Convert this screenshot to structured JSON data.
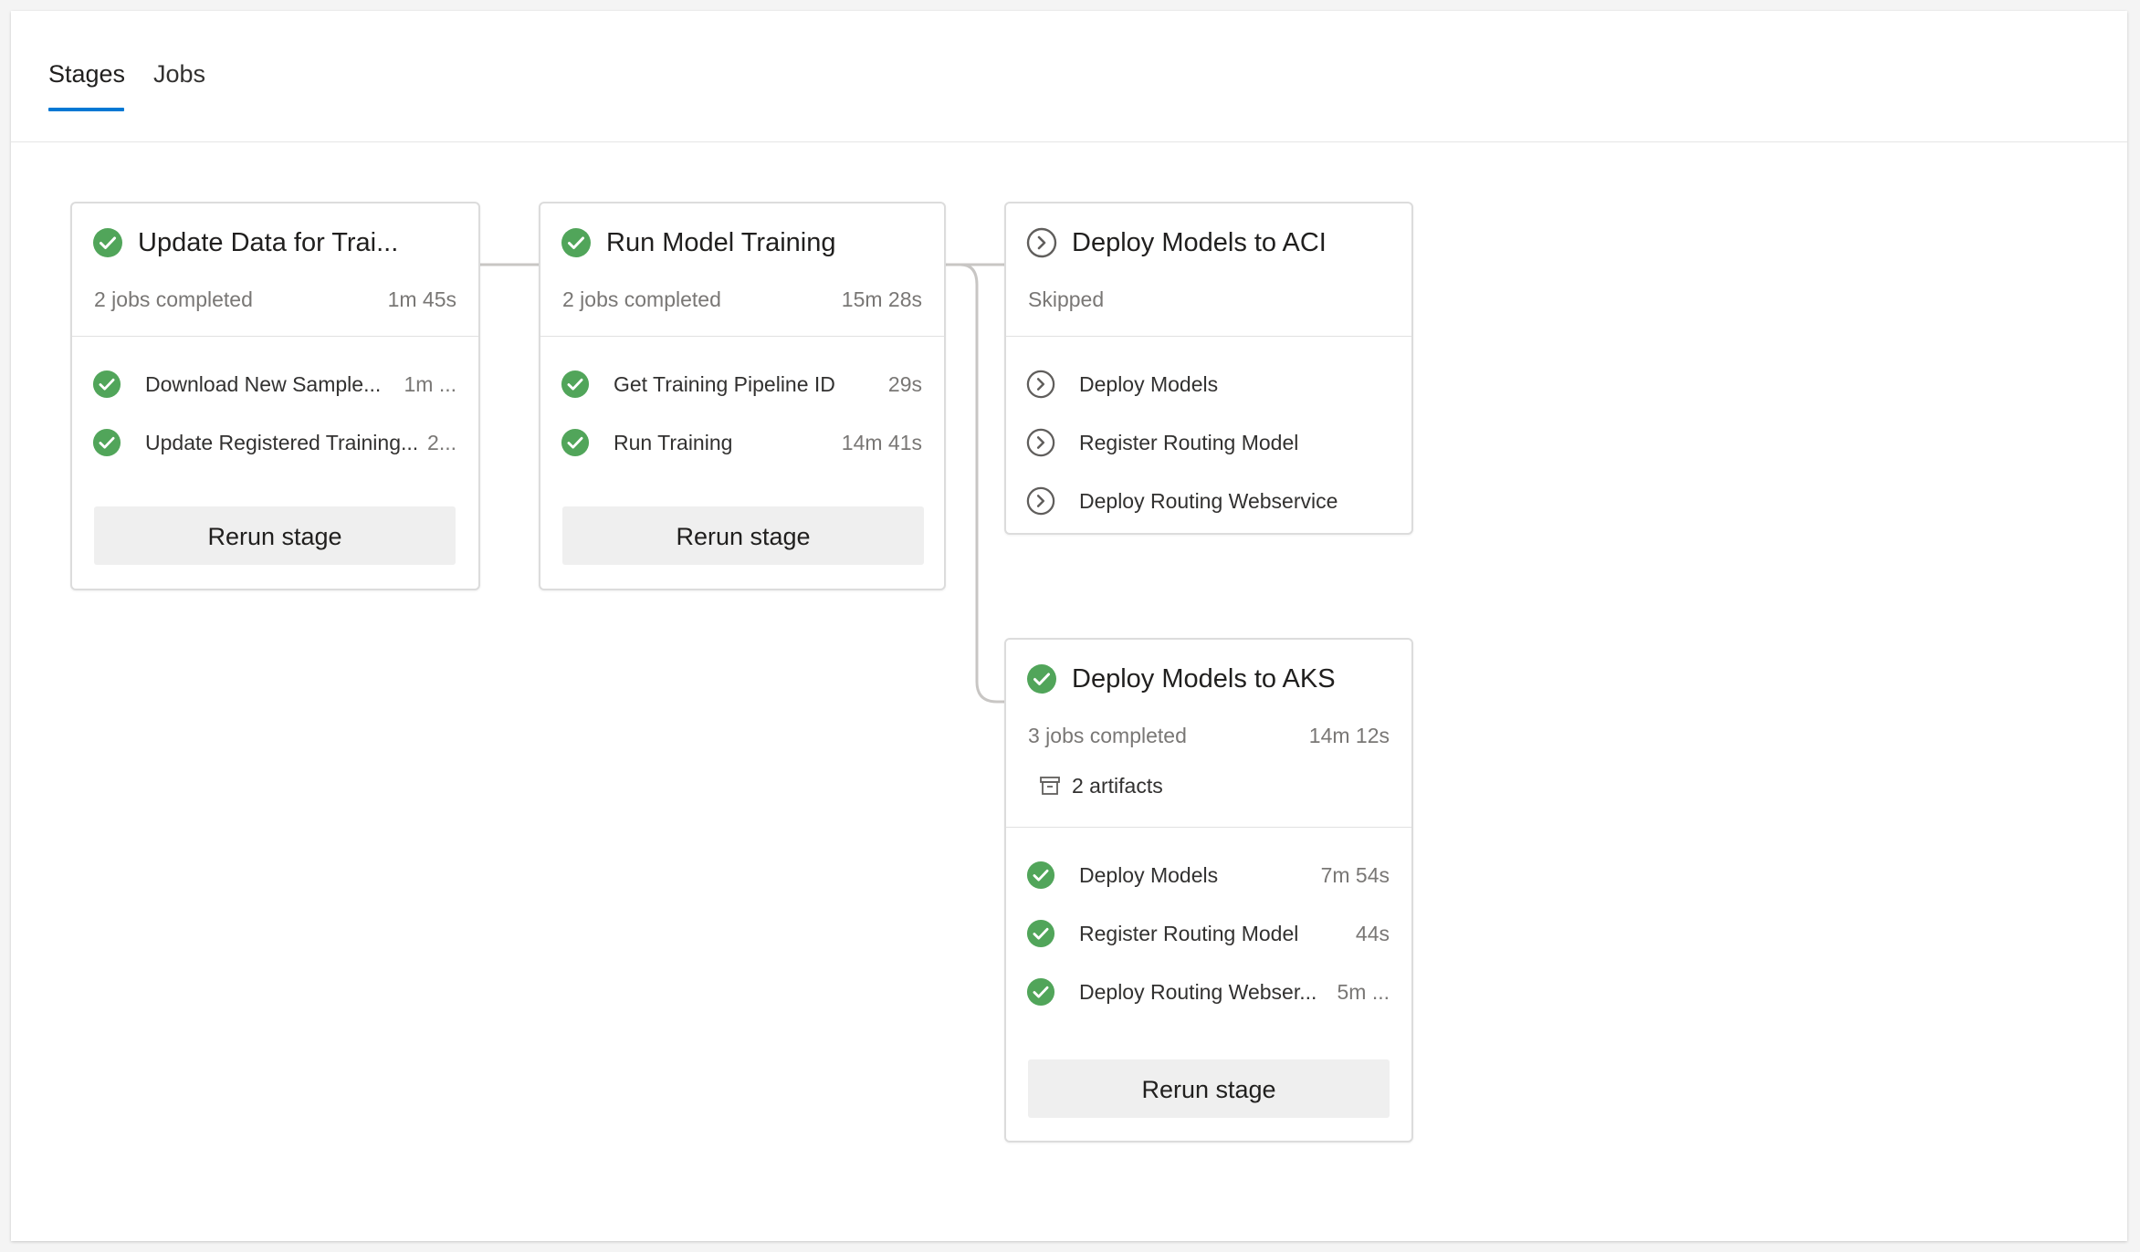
{
  "tabs": [
    {
      "label": "Stages",
      "active": true
    },
    {
      "label": "Jobs",
      "active": false
    }
  ],
  "colors": {
    "success": "#51a55a",
    "skipped": "#605e5c",
    "accent": "#0078d4",
    "connector": "#c8c6c4"
  },
  "stages": [
    {
      "title": "Update Data for Trai...",
      "status": "succeeded",
      "status_icon": "check-circle-icon",
      "summary": "2 jobs completed",
      "duration": "1m 45s",
      "jobs": [
        {
          "name": "Download New Sample...",
          "duration": "1m ...",
          "status": "succeeded"
        },
        {
          "name": "Update Registered Training...",
          "duration": "2...",
          "status": "succeeded"
        }
      ],
      "rerun_label": "Rerun stage"
    },
    {
      "title": "Run Model Training",
      "status": "succeeded",
      "status_icon": "check-circle-icon",
      "summary": "2 jobs completed",
      "duration": "15m 28s",
      "jobs": [
        {
          "name": "Get Training Pipeline ID",
          "duration": "29s",
          "status": "succeeded"
        },
        {
          "name": "Run Training",
          "duration": "14m 41s",
          "status": "succeeded"
        }
      ],
      "rerun_label": "Rerun stage"
    },
    {
      "title": "Deploy Models to ACI",
      "status": "skipped",
      "status_icon": "skipped-circle-icon",
      "summary": "Skipped",
      "duration": "",
      "jobs": [
        {
          "name": "Deploy Models",
          "duration": "",
          "status": "skipped"
        },
        {
          "name": "Register Routing Model",
          "duration": "",
          "status": "skipped"
        },
        {
          "name": "Deploy Routing Webservice",
          "duration": "",
          "status": "skipped"
        }
      ]
    },
    {
      "title": "Deploy Models to AKS",
      "status": "succeeded",
      "status_icon": "check-circle-icon",
      "summary": "3 jobs completed",
      "duration": "14m 12s",
      "artifacts": "2 artifacts",
      "jobs": [
        {
          "name": "Deploy Models",
          "duration": "7m 54s",
          "status": "succeeded"
        },
        {
          "name": "Register Routing Model",
          "duration": "44s",
          "status": "succeeded"
        },
        {
          "name": "Deploy Routing Webser...",
          "duration": "5m ...",
          "status": "succeeded"
        }
      ],
      "rerun_label": "Rerun stage"
    }
  ]
}
